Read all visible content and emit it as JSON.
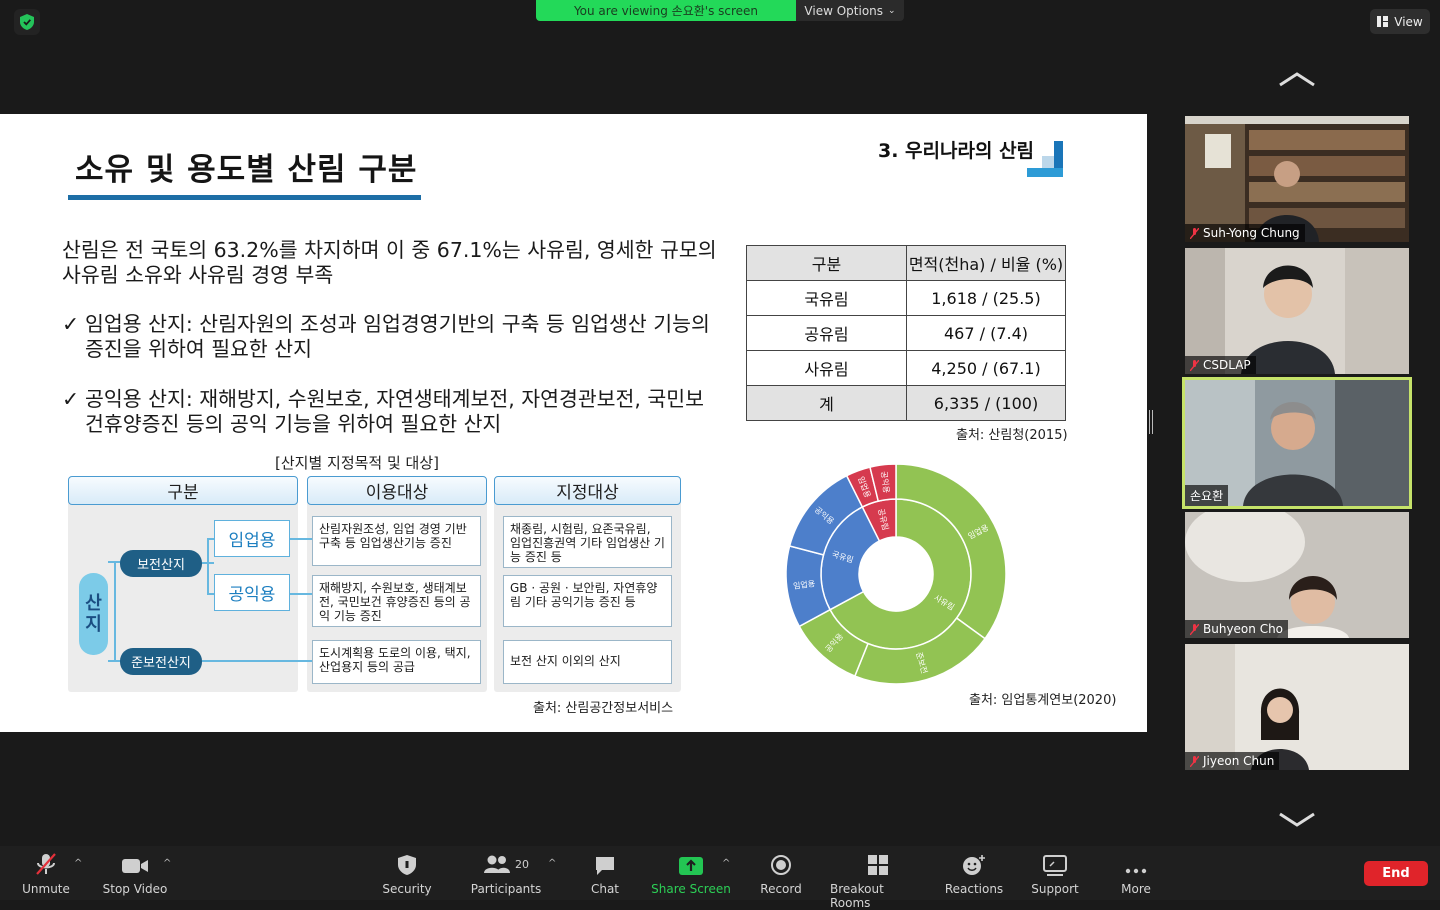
{
  "topbar": {
    "viewing_banner": "You are viewing 손요환's screen",
    "view_options": "View Options",
    "view_button": "View"
  },
  "slide": {
    "title": "소유 및 용도별 산림 구분",
    "section_label": "3. 우리나라의 산림",
    "intro": "산림은 전 국토의 63.2%를 차지하며 이 중 67.1%는 사유림, 영세한 규모의 사유림 소유와 사유림 경영 부족",
    "bullets": [
      {
        "check": "✓",
        "text": "임업용 산지: 산림자원의 조성과 임업경영기반의 구축 등 임업생산 기능의 증진을 위하여 필요한 산지"
      },
      {
        "check": "✓",
        "text": "공익용 산지: 재해방지, 수원보호, 자연생태계보전, 자연경관보전, 국민보건휴양증진 등의 공익 기능을 위하여 필요한 산지"
      }
    ],
    "table": {
      "headers": [
        "구분",
        "면적(천ha) / 비율 (%)"
      ],
      "rows": [
        [
          "국유림",
          "1,618 / (25.5)"
        ],
        [
          "공유림",
          "467 / (7.4)"
        ],
        [
          "사유림",
          "4,250 / (67.1)"
        ],
        [
          "계",
          "6,335 / (100)"
        ]
      ],
      "source": "출처: 산림청(2015)"
    },
    "diagram": {
      "title": "[산지별 지정목적 및 대상]",
      "col_headers": [
        "구분",
        "이용대상",
        "지정대상"
      ],
      "root": "산\n지",
      "nodes": {
        "preserve": "보전산지",
        "semi": "준보전산지",
        "forestry": "임업용",
        "public": "공익용"
      },
      "usage": [
        "산림자원조성, 임업 경영 기반 구축 등 임업생산기능 증진",
        "재해방지, 수원보호, 생태계보전, 국민보건 휴양증진 등의 공익 기능 증진",
        "도시계획용 도로의 이용, 택지, 산업용지 등의 공급"
      ],
      "targets": [
        "채종림, 시험림, 요존국유림, 임업진흥권역 기타 임업생산 기능 증진 등",
        "GB · 공원 · 보안림, 자연휴양림 기타 공익기능 증진 등",
        "보전 산지 이외의 산지"
      ],
      "source": "출처: 산림공간정보서비스"
    },
    "chart_source": "출처: 임업통계연보(2020)"
  },
  "chart_data": {
    "type": "sunburst",
    "inner": [
      {
        "name": "사유림",
        "value": 67.1,
        "color": "#92c353"
      },
      {
        "name": "국유림",
        "value": 25.5,
        "color": "#4d7fcb"
      },
      {
        "name": "공유림",
        "value": 7.4,
        "color": "#d63a4e"
      }
    ],
    "outer": [
      {
        "name": "임업용",
        "parent": "사유림",
        "value": 35.0,
        "color": "#92c353"
      },
      {
        "name": "준보전",
        "parent": "사유림",
        "value": 21.1,
        "color": "#92c353"
      },
      {
        "name": "공익용",
        "parent": "사유림",
        "value": 11.0,
        "color": "#92c353"
      },
      {
        "name": "임업용",
        "parent": "국유림",
        "value": 12.0,
        "color": "#4d7fcb"
      },
      {
        "name": "공익용",
        "parent": "국유림",
        "value": 13.5,
        "color": "#4d7fcb"
      },
      {
        "name": "임업용",
        "parent": "공유림",
        "value": 3.6,
        "color": "#d63a4e"
      },
      {
        "name": "공익용",
        "parent": "공유림",
        "value": 3.8,
        "color": "#d63a4e"
      }
    ]
  },
  "participants": [
    {
      "name": "Suh-Yong Chung",
      "muted": true
    },
    {
      "name": "CSDLAP",
      "muted": true
    },
    {
      "name": "손요환",
      "muted": false,
      "active": true
    },
    {
      "name": "Buhyeon Cho",
      "muted": true
    },
    {
      "name": "Jiyeon Chun",
      "muted": true
    }
  ],
  "toolbar": {
    "unmute": "Unmute",
    "stop_video": "Stop Video",
    "security": "Security",
    "participants": "Participants",
    "participants_count": "20",
    "chat": "Chat",
    "share_screen": "Share Screen",
    "record": "Record",
    "breakout_rooms": "Breakout Rooms",
    "reactions": "Reactions",
    "support": "Support",
    "more": "More",
    "end": "End"
  },
  "colors": {
    "banner_green": "#23d959",
    "title_underline": "#1d6ea6",
    "active_speaker_border": "#c6e36a",
    "end_red": "#e0242a",
    "share_green": "#2ccf56"
  }
}
